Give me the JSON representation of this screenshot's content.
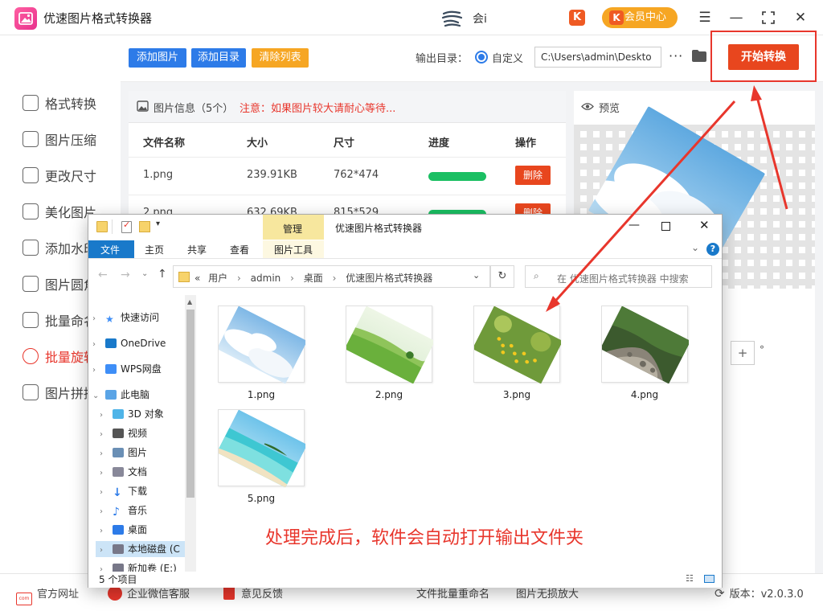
{
  "app": {
    "title": "优速图片格式转换器",
    "user_name": "会i",
    "svip_badge": "K",
    "member_button": "会员中心",
    "member_badge": "K",
    "accent": "#e8461e"
  },
  "sidebar": {
    "items": [
      {
        "label": "格式转换",
        "icon": "swap-icon"
      },
      {
        "label": "图片压缩",
        "icon": "compress-icon"
      },
      {
        "label": "更改尺寸",
        "icon": "resize-icon"
      },
      {
        "label": "美化图片",
        "icon": "beautify-icon"
      },
      {
        "label": "添加水印",
        "icon": "watermark-icon"
      },
      {
        "label": "图片圆角",
        "icon": "rounded-corner-icon"
      },
      {
        "label": "批量命名",
        "icon": "rename-icon"
      },
      {
        "label": "批量旋转",
        "icon": "rotate-icon"
      },
      {
        "label": "图片拼接",
        "icon": "stitch-icon"
      }
    ]
  },
  "toolbar": {
    "add_image": "添加图片",
    "add_folder": "添加目录",
    "clear_list": "清除列表",
    "output_label": "输出目录：",
    "radio_custom": "自定义",
    "output_path": "C:\\Users\\admin\\Deskto",
    "more": "···",
    "start": "开始转换"
  },
  "file_list": {
    "title": "图片信息（5个）",
    "notice": "注意：如果图片较大请耐心等待...",
    "headers": [
      "文件名称",
      "大小",
      "尺寸",
      "进度",
      "操作"
    ],
    "rows": [
      {
        "name": "1.png",
        "size": "239.91KB",
        "dims": "762*474",
        "progress": 1.0,
        "action": "删除"
      },
      {
        "name": "2.png",
        "size": "632.69KB",
        "dims": "815*529",
        "progress": 1.0,
        "action": "删除"
      }
    ]
  },
  "preview": {
    "title": "预览",
    "rotate_plus": "+",
    "rotate_unit": "°"
  },
  "bottom_bar": {
    "website": "官方网址",
    "wechat": "企业微信客服",
    "feedback": "意见反馈",
    "batch_rename": "文件批量重命名",
    "lossless_enlarge": "图片无损放大",
    "version": "版本：v2.0.3.0"
  },
  "explorer": {
    "manage_tab": "管理",
    "window_title": "优速图片格式转换器",
    "ribbon_tabs": [
      "文件",
      "主页",
      "共享",
      "查看",
      "图片工具"
    ],
    "breadcrumb": [
      "用户",
      "admin",
      "桌面",
      "优速图片格式转换器"
    ],
    "breadcrumb_prefix": "«",
    "search_placeholder": "在 优速图片格式转换器 中搜索",
    "nav": [
      {
        "label": "快速访问",
        "icon": "star-icon"
      },
      {
        "label": "OneDrive",
        "icon": "cloud-icon"
      },
      {
        "label": "WPS网盘",
        "icon": "wps-cloud-icon"
      },
      {
        "label": "此电脑",
        "icon": "computer-icon"
      },
      {
        "label": "3D 对象",
        "icon": "3d-objects-icon"
      },
      {
        "label": "视频",
        "icon": "video-icon"
      },
      {
        "label": "图片",
        "icon": "pictures-icon"
      },
      {
        "label": "文档",
        "icon": "documents-icon"
      },
      {
        "label": "下载",
        "icon": "download-icon"
      },
      {
        "label": "音乐",
        "icon": "music-icon"
      },
      {
        "label": "桌面",
        "icon": "desktop-icon"
      },
      {
        "label": "本地磁盘 (C",
        "icon": "drive-icon"
      },
      {
        "label": "新加卷 (E:)",
        "icon": "drive-icon"
      }
    ],
    "files": [
      "1.png",
      "2.png",
      "3.png",
      "4.png",
      "5.png"
    ],
    "status": "5 个项目"
  },
  "annotation": "处理完成后，软件会自动打开输出文件夹"
}
